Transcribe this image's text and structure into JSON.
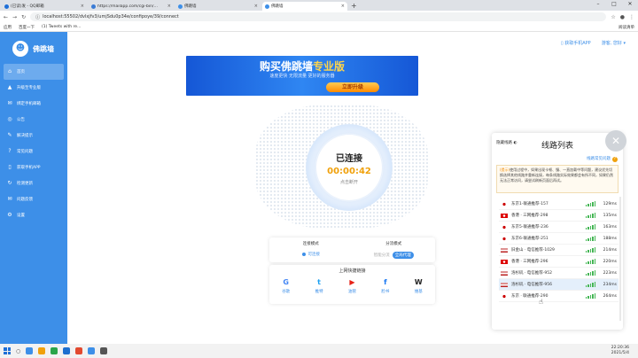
{
  "browser": {
    "tabs": [
      {
        "label": "(已读)发 - QQ邮箱",
        "color": "#1e6fd8"
      },
      {
        "label": "https://mailapp.com/cgi-bin/…",
        "color": "#3a7bd5"
      },
      {
        "label": "佛跳墙",
        "color": "#3d8fe8"
      },
      {
        "label": "佛跳墙",
        "color": "#3d8fe8"
      }
    ],
    "new_tab": "+",
    "url": "localhost:55502/dvlxjfv3/umjSdu0p34e/confipoye/39/connect",
    "bookmarks": [
      "应用",
      "百度一下",
      "(1) Tweets with re..."
    ],
    "reading_list": "阅读清单"
  },
  "sidebar": {
    "app_name": "佛跳墙",
    "items": [
      {
        "label": "首页",
        "icon": "home-icon",
        "glyph": "⌂",
        "active": true
      },
      {
        "label": "升级至专业版",
        "icon": "upgrade-icon",
        "glyph": "▲",
        "active": false
      },
      {
        "label": "绑定手机邮箱",
        "icon": "bind-icon",
        "glyph": "✉",
        "active": false
      },
      {
        "label": "公告",
        "icon": "notice-icon",
        "glyph": "◎",
        "active": false
      },
      {
        "label": "解决提示",
        "icon": "tip-icon",
        "glyph": "✎",
        "active": false
      },
      {
        "label": "常见问题",
        "icon": "faq-icon",
        "glyph": "?",
        "active": false
      },
      {
        "label": "获取手机APP",
        "icon": "phone-icon",
        "glyph": "▯",
        "active": false
      },
      {
        "label": "检测更新",
        "icon": "update-icon",
        "glyph": "↻",
        "active": false
      },
      {
        "label": "问题反馈",
        "icon": "feedback-icon",
        "glyph": "✉",
        "active": false
      },
      {
        "label": "设置",
        "icon": "settings-icon",
        "glyph": "⚙",
        "active": false
      }
    ]
  },
  "topbar": {
    "get_app": "获取手机APP",
    "user": "游客, 您好"
  },
  "banner": {
    "title_main": "购买佛跳墙",
    "title_pro": "专业版",
    "subtitle": "速度更快 无限流量 更好的服务器",
    "button": "立即升级"
  },
  "status": {
    "state": "已连接",
    "timer": "00:00:42",
    "disconnect": "点击断开"
  },
  "modes": {
    "connect_mode_label": "连接模式",
    "connect_mode_value": "可连接",
    "proxy_mode_label": "分流模式",
    "proxy_mode_options": [
      "智能分流",
      "全局代理"
    ]
  },
  "quick": {
    "title": "上网快捷链接",
    "links": [
      {
        "label": "谷歌",
        "glyph": "G",
        "color": "#4285f4",
        "icon": "google-icon"
      },
      {
        "label": "推特",
        "glyph": "t",
        "color": "#1da1f2",
        "icon": "twitter-icon"
      },
      {
        "label": "油管",
        "glyph": "▶",
        "color": "#e62117",
        "icon": "youtube-icon"
      },
      {
        "label": "脸书",
        "glyph": "f",
        "color": "#1877f2",
        "icon": "facebook-icon"
      },
      {
        "label": "维基",
        "glyph": "W",
        "color": "#222222",
        "icon": "wikipedia-icon"
      }
    ]
  },
  "line_panel": {
    "mode": "隐藏线路",
    "title": "线路列表",
    "help": "线路常见问题",
    "tip_prefix": "(提示)",
    "tip": "使用过程中，如果出现卡顿、慢、一直加载中等问题，建议优先切换选择其他线路并重新连接，每条线路实际效果都会有所不同，如果仍然无法正常访问，请尝试刷新页面后再试。",
    "lines": [
      {
        "flag": "jp",
        "name": "东京1-联通推荐-157",
        "ms": "129ms",
        "selected": false
      },
      {
        "flag": "hk",
        "name": "香港 · 三网推荐-298",
        "ms": "135ms",
        "selected": false
      },
      {
        "flag": "jp",
        "name": "东京5-联通推荐-236",
        "ms": "163ms",
        "selected": false
      },
      {
        "flag": "jp",
        "name": "东京6-联通推荐-251",
        "ms": "188ms",
        "selected": false
      },
      {
        "flag": "us",
        "name": "旧金山 · 电信推荐-1029",
        "ms": "214ms",
        "selected": false
      },
      {
        "flag": "hk",
        "name": "香港 · 三网推荐-296",
        "ms": "220ms",
        "selected": false
      },
      {
        "flag": "us",
        "name": "洛杉矶 · 电信推荐-952",
        "ms": "223ms",
        "selected": false
      },
      {
        "flag": "us",
        "name": "洛杉矶 · 电信推荐-956",
        "ms": "234ms",
        "selected": true
      },
      {
        "flag": "jp",
        "name": "东京 · 联通推荐-290",
        "ms": "264ms",
        "selected": false
      }
    ]
  },
  "taskbar": {
    "time": "22:20:36",
    "date": "2021/5/4",
    "tray": "^ 中"
  },
  "colors": {
    "accent": "#3d8fe8",
    "timer": "#f0a10c",
    "signal": "#44b654"
  }
}
